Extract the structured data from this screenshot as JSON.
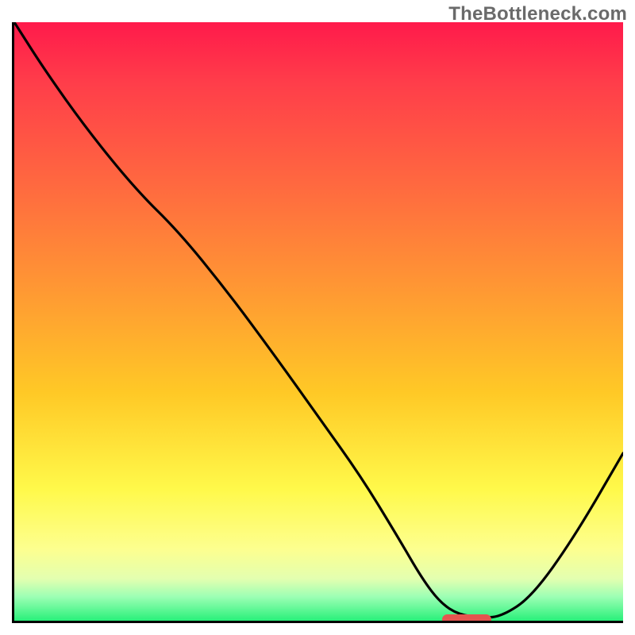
{
  "watermark": "TheBottleneck.com",
  "colors": {
    "axis": "#000000",
    "curve": "#000000",
    "marker": "#e5554f",
    "watermark": "#6a6a6a"
  },
  "chart_data": {
    "type": "line",
    "title": "",
    "xlabel": "",
    "ylabel": "",
    "xlim": [
      0,
      100
    ],
    "ylim": [
      0,
      100
    ],
    "grid": false,
    "legend": false,
    "x": [
      0,
      5,
      12,
      20,
      27,
      35,
      43,
      50,
      57,
      63,
      67,
      70,
      73,
      77,
      80,
      85,
      92,
      100
    ],
    "values": [
      100,
      92,
      82,
      72,
      65,
      55,
      44,
      34,
      24,
      14,
      7,
      3,
      1,
      0.5,
      0.7,
      4,
      14,
      28
    ],
    "marker": {
      "x_min": 70,
      "x_max": 78,
      "y": 0.5
    }
  }
}
